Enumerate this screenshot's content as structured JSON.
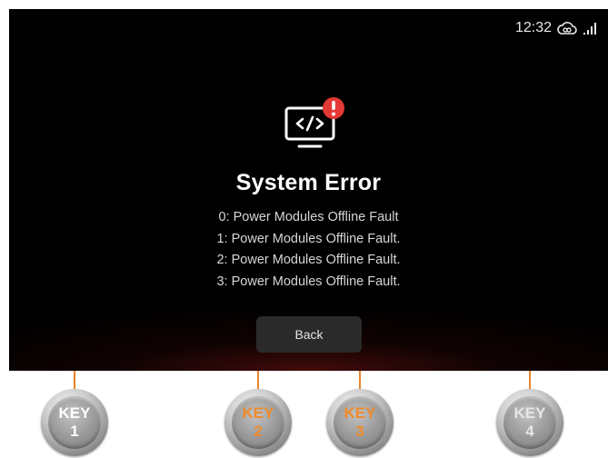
{
  "status_bar": {
    "time": "12:32",
    "cloud_icon": "cloud-link-icon",
    "signal_icon": "signal-bars-icon"
  },
  "error": {
    "icon": "monitor-code-error-icon",
    "badge_color": "#e53935",
    "title": "System Error",
    "faults": [
      "0: Power Modules Offline Fault",
      "1: Power Modules Offline Fault.",
      "2: Power Modules Offline Fault.",
      "3: Power Modules Offline Fault."
    ]
  },
  "back_button": {
    "label": "Back"
  },
  "keys": [
    {
      "label": "KEY",
      "number": "1",
      "color": "#ffffff"
    },
    {
      "label": "KEY",
      "number": "2",
      "color": "#ef8a2a"
    },
    {
      "label": "KEY",
      "number": "3",
      "color": "#ef8a2a"
    },
    {
      "label": "KEY",
      "number": "4",
      "color": "#e6e6e6"
    }
  ],
  "colors": {
    "screen_bg": "#000000",
    "accent": "#e8842a"
  }
}
